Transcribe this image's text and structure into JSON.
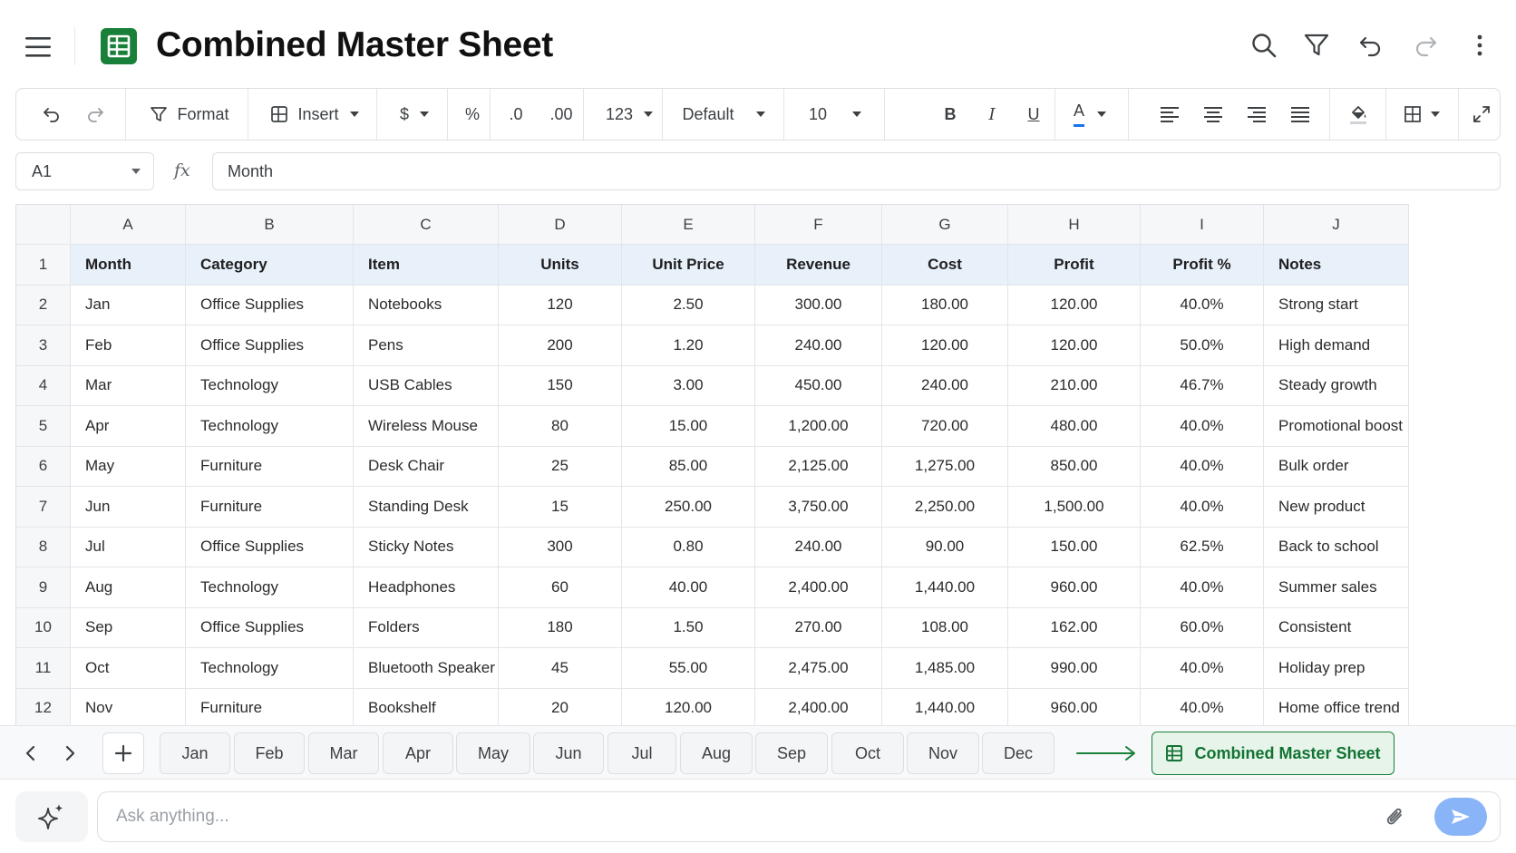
{
  "header": {
    "title": "Combined Master Sheet"
  },
  "toolbar": {
    "format_label": "Format",
    "insert_label": "Insert",
    "currency_label": "$",
    "percent_label": "%",
    "decrease_decimal_label": ".0",
    "increase_decimal_label": ".00",
    "number_format_label": "123",
    "font_label": "Default",
    "font_size_label": "10",
    "bold_label": "B",
    "italic_label": "I",
    "underline_label": "U",
    "text_color_label": "A",
    "text_color": "#1a73e8"
  },
  "formula_bar": {
    "cell_ref": "A1",
    "fx_label": "fx",
    "value": "Month"
  },
  "grid": {
    "columns": [
      "A",
      "B",
      "C",
      "D",
      "E",
      "F",
      "G",
      "H",
      "I",
      "J"
    ],
    "row_numbers": [
      "1",
      "2",
      "3",
      "4",
      "5",
      "6",
      "7",
      "8",
      "9",
      "10",
      "11",
      "12"
    ],
    "header": [
      "Month",
      "Category",
      "Item",
      "Units",
      "Unit Price",
      "Revenue",
      "Cost",
      "Profit",
      "Profit %",
      "Notes"
    ],
    "rows": [
      [
        "Jan",
        "Office Supplies",
        "Notebooks",
        "120",
        "2.50",
        "300.00",
        "180.00",
        "120.00",
        "40.0%",
        "Strong start"
      ],
      [
        "Feb",
        "Office Supplies",
        "Pens",
        "200",
        "1.20",
        "240.00",
        "120.00",
        "120.00",
        "50.0%",
        "High demand"
      ],
      [
        "Mar",
        "Technology",
        "USB Cables",
        "150",
        "3.00",
        "450.00",
        "240.00",
        "210.00",
        "46.7%",
        "Steady growth"
      ],
      [
        "Apr",
        "Technology",
        "Wireless Mouse",
        "80",
        "15.00",
        "1,200.00",
        "720.00",
        "480.00",
        "40.0%",
        "Promotional boost"
      ],
      [
        "May",
        "Furniture",
        "Desk Chair",
        "25",
        "85.00",
        "2,125.00",
        "1,275.00",
        "850.00",
        "40.0%",
        "Bulk order"
      ],
      [
        "Jun",
        "Furniture",
        "Standing Desk",
        "15",
        "250.00",
        "3,750.00",
        "2,250.00",
        "1,500.00",
        "40.0%",
        "New product"
      ],
      [
        "Jul",
        "Office Supplies",
        "Sticky Notes",
        "300",
        "0.80",
        "240.00",
        "90.00",
        "150.00",
        "62.5%",
        "Back to school"
      ],
      [
        "Aug",
        "Technology",
        "Headphones",
        "60",
        "40.00",
        "2,400.00",
        "1,440.00",
        "960.00",
        "40.0%",
        "Summer sales"
      ],
      [
        "Sep",
        "Office Supplies",
        "Folders",
        "180",
        "1.50",
        "270.00",
        "108.00",
        "162.00",
        "60.0%",
        "Consistent"
      ],
      [
        "Oct",
        "Technology",
        "Bluetooth Speaker",
        "45",
        "55.00",
        "2,475.00",
        "1,485.00",
        "990.00",
        "40.0%",
        "Holiday prep"
      ],
      [
        "Nov",
        "Furniture",
        "Bookshelf",
        "20",
        "120.00",
        "2,400.00",
        "1,440.00",
        "960.00",
        "40.0%",
        "Home office trend"
      ]
    ]
  },
  "tabs": {
    "sheets": [
      "Jan",
      "Feb",
      "Mar",
      "Apr",
      "May",
      "Jun",
      "Jul",
      "Aug",
      "Sep",
      "Oct",
      "Nov",
      "Dec"
    ],
    "active": "Combined Master Sheet"
  },
  "ask": {
    "placeholder": "Ask anything..."
  },
  "colors": {
    "accent_green": "#188038",
    "header_row_bg": "#e8f0fa",
    "send_button": "#8ab4f8"
  }
}
